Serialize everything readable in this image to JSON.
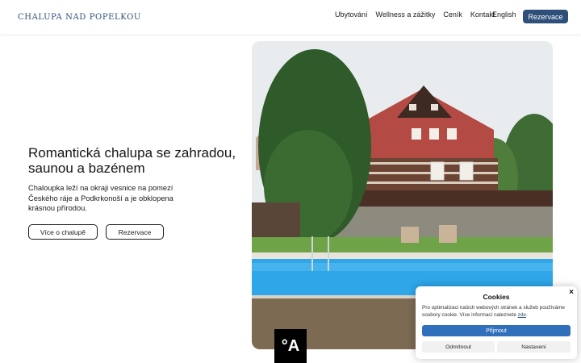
{
  "brand": {
    "name": "Chalupa nad Popelkou",
    "logo_text": "CHALUPA NAD POPELKOU"
  },
  "nav": {
    "items": [
      {
        "label": "Ubytování"
      },
      {
        "label": "Wellness a zážitky"
      },
      {
        "label": "Ceník"
      },
      {
        "label": "Kontakt"
      }
    ],
    "language": "English",
    "reserve_label": "Rezervace"
  },
  "hero": {
    "title": "Romantická chalupa se zahradou, saunou a bazénem",
    "description": "Chaloupka leží na okraji vesnice na pomezí Českého ráje a Podkrkonoší a je obklopena krásnou přírodou.",
    "more_label": "Více o chalupě",
    "reserve_label": "Rezervace"
  },
  "badge": {
    "text": "°A"
  },
  "cookies": {
    "title": "Cookies",
    "close": "×",
    "text": "Pro optimalizaci našich webových stránek a služeb používáme soubory cookie. Více informací naleznete ",
    "link": "zde",
    "text_end": ".",
    "accept": "Přijmout",
    "deny": "Odmítnout",
    "settings": "Nastavení"
  },
  "colors": {
    "brand": "#2d4f7a",
    "accept": "#2f6fbb"
  },
  "icons": {
    "logo": "cottage-logo-icon",
    "close": "close-icon"
  }
}
